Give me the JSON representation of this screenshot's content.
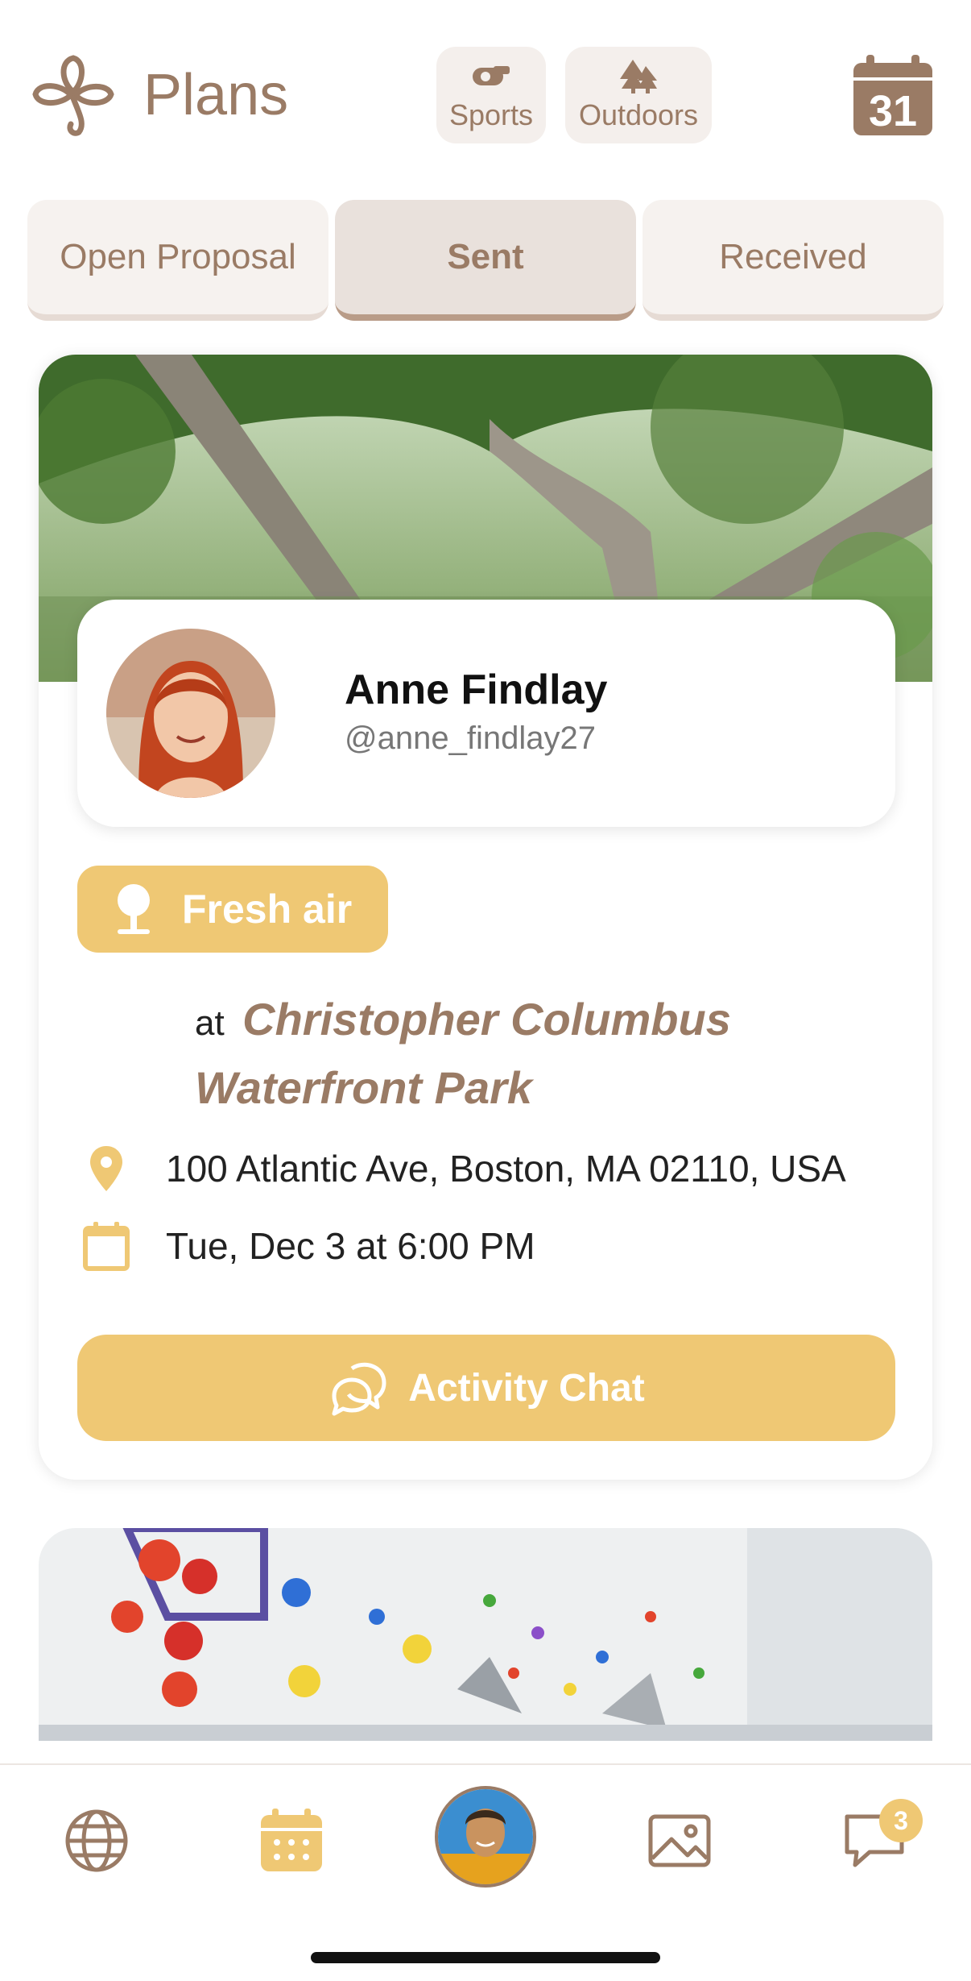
{
  "header": {
    "title": "Plans",
    "calendar_day": "31"
  },
  "filters": [
    {
      "label": "Sports",
      "icon": "whistle-icon"
    },
    {
      "label": "Outdoors",
      "icon": "trees-icon"
    }
  ],
  "segments": {
    "items": [
      "Open Proposal",
      "Sent",
      "Received"
    ],
    "selected": "Sent"
  },
  "plan_card": {
    "name": "Anne Findlay",
    "handle": "@anne_findlay27",
    "badge": "Fresh air",
    "at_word": "at",
    "place": "Christopher Columbus Waterfront Park",
    "address": "100 Atlantic Ave, Boston, MA 02110, USA",
    "datetime": "Tue, Dec 3 at 6:00 PM",
    "chat_button": "Activity Chat"
  },
  "tabbar": {
    "items": [
      "globe-icon",
      "calendar-icon",
      "profile-avatar",
      "photo-icon",
      "chat-icon"
    ],
    "active": "calendar-icon",
    "chat_badge": "3"
  },
  "colors": {
    "brand_brown": "#9a7b65",
    "accent_yellow": "#efc874",
    "chip_bg": "#f4efec"
  }
}
